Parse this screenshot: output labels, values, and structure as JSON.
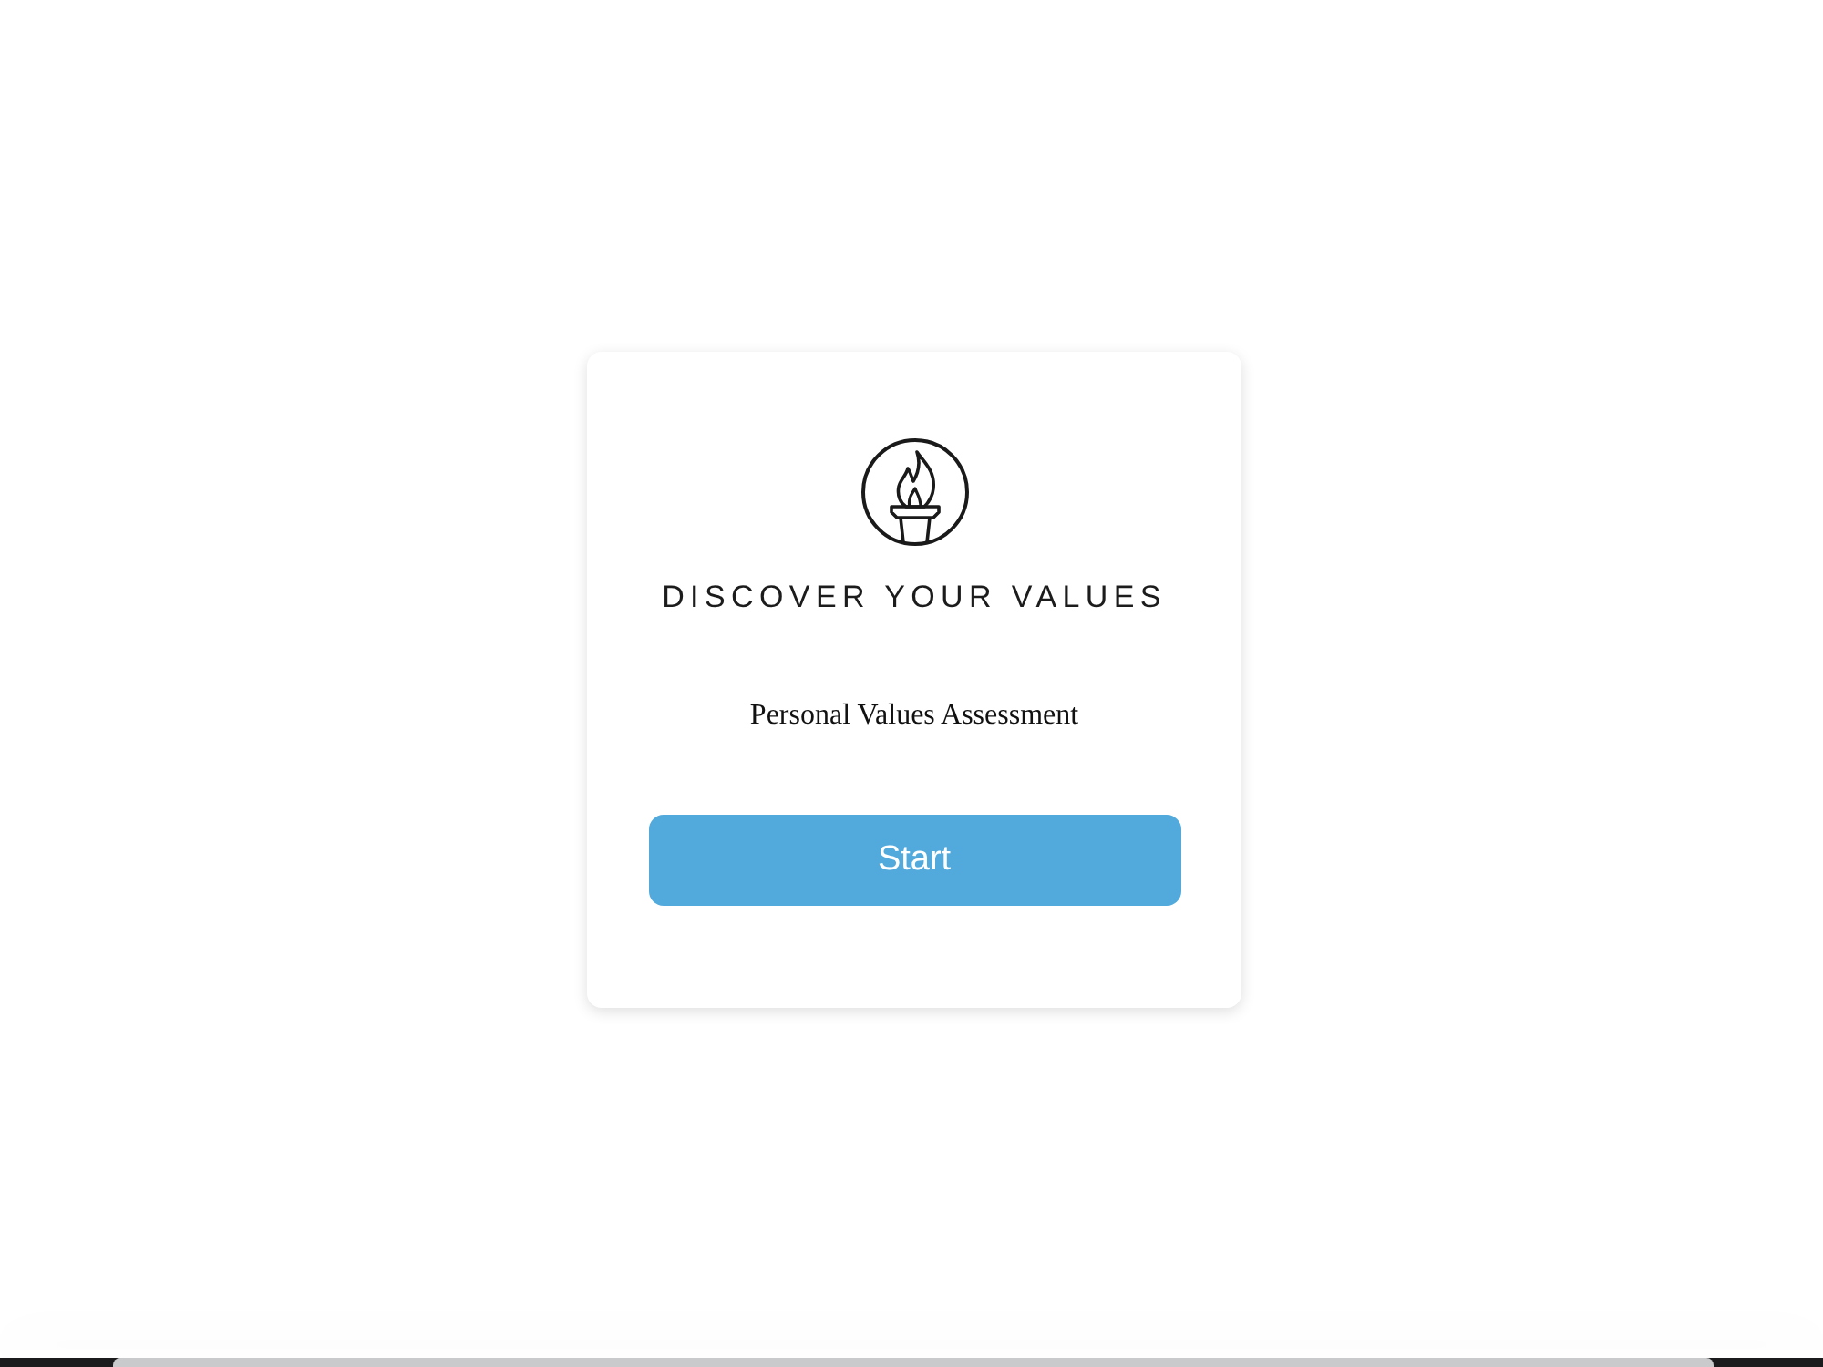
{
  "card": {
    "title": "DISCOVER YOUR VALUES",
    "subtitle": "Personal Values Assessment",
    "button": {
      "label": "Start"
    }
  }
}
